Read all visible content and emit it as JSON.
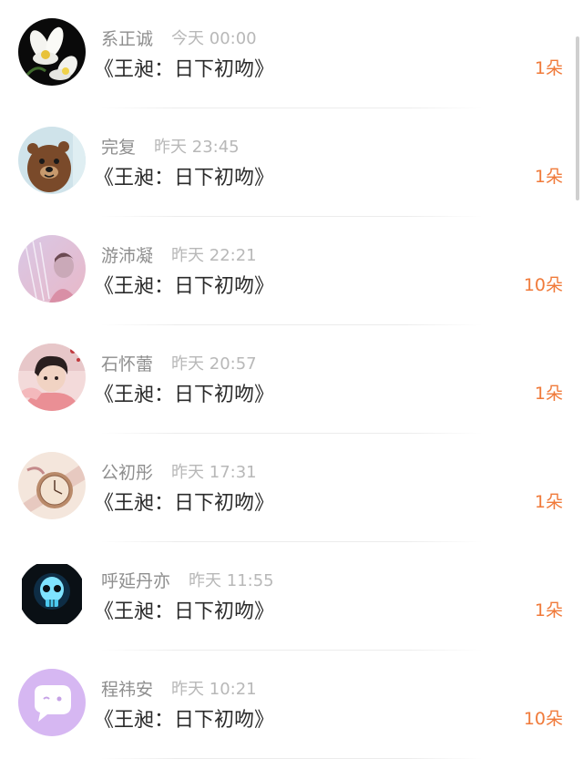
{
  "messages": [
    {
      "name": "系正诚",
      "time": "今天 00:00",
      "title": "《王昶：日下初吻》",
      "count": "1朵",
      "avatar": "orchid-flower-icon"
    },
    {
      "name": "完复",
      "time": "昨天 23:45",
      "title": "《王昶：日下初吻》",
      "count": "1朵",
      "avatar": "brown-bear-icon"
    },
    {
      "name": "游沛凝",
      "time": "昨天 22:21",
      "title": "《王昶：日下初吻》",
      "count": "10朵",
      "avatar": "pink-portrait-icon"
    },
    {
      "name": "石怀蕾",
      "time": "昨天 20:57",
      "title": "《王昶：日下初吻》",
      "count": "1朵",
      "avatar": "boy-portrait-icon"
    },
    {
      "name": "公初彤",
      "time": "昨天 17:31",
      "title": "《王昶：日下初吻》",
      "count": "1朵",
      "avatar": "pocket-watch-icon"
    },
    {
      "name": "呼延丹亦",
      "time": "昨天 11:55",
      "title": "《王昶：日下初吻》",
      "count": "1朵",
      "avatar": "glowing-skull-icon"
    },
    {
      "name": "程祎安",
      "time": "昨天 10:21",
      "title": "《王昶：日下初吻》",
      "count": "10朵",
      "avatar": "chat-bubble-icon"
    }
  ],
  "colors": {
    "accent": "#f07a3a",
    "name": "#8e8e8e",
    "time": "#b8b8b8",
    "title": "#2b2b2b"
  }
}
